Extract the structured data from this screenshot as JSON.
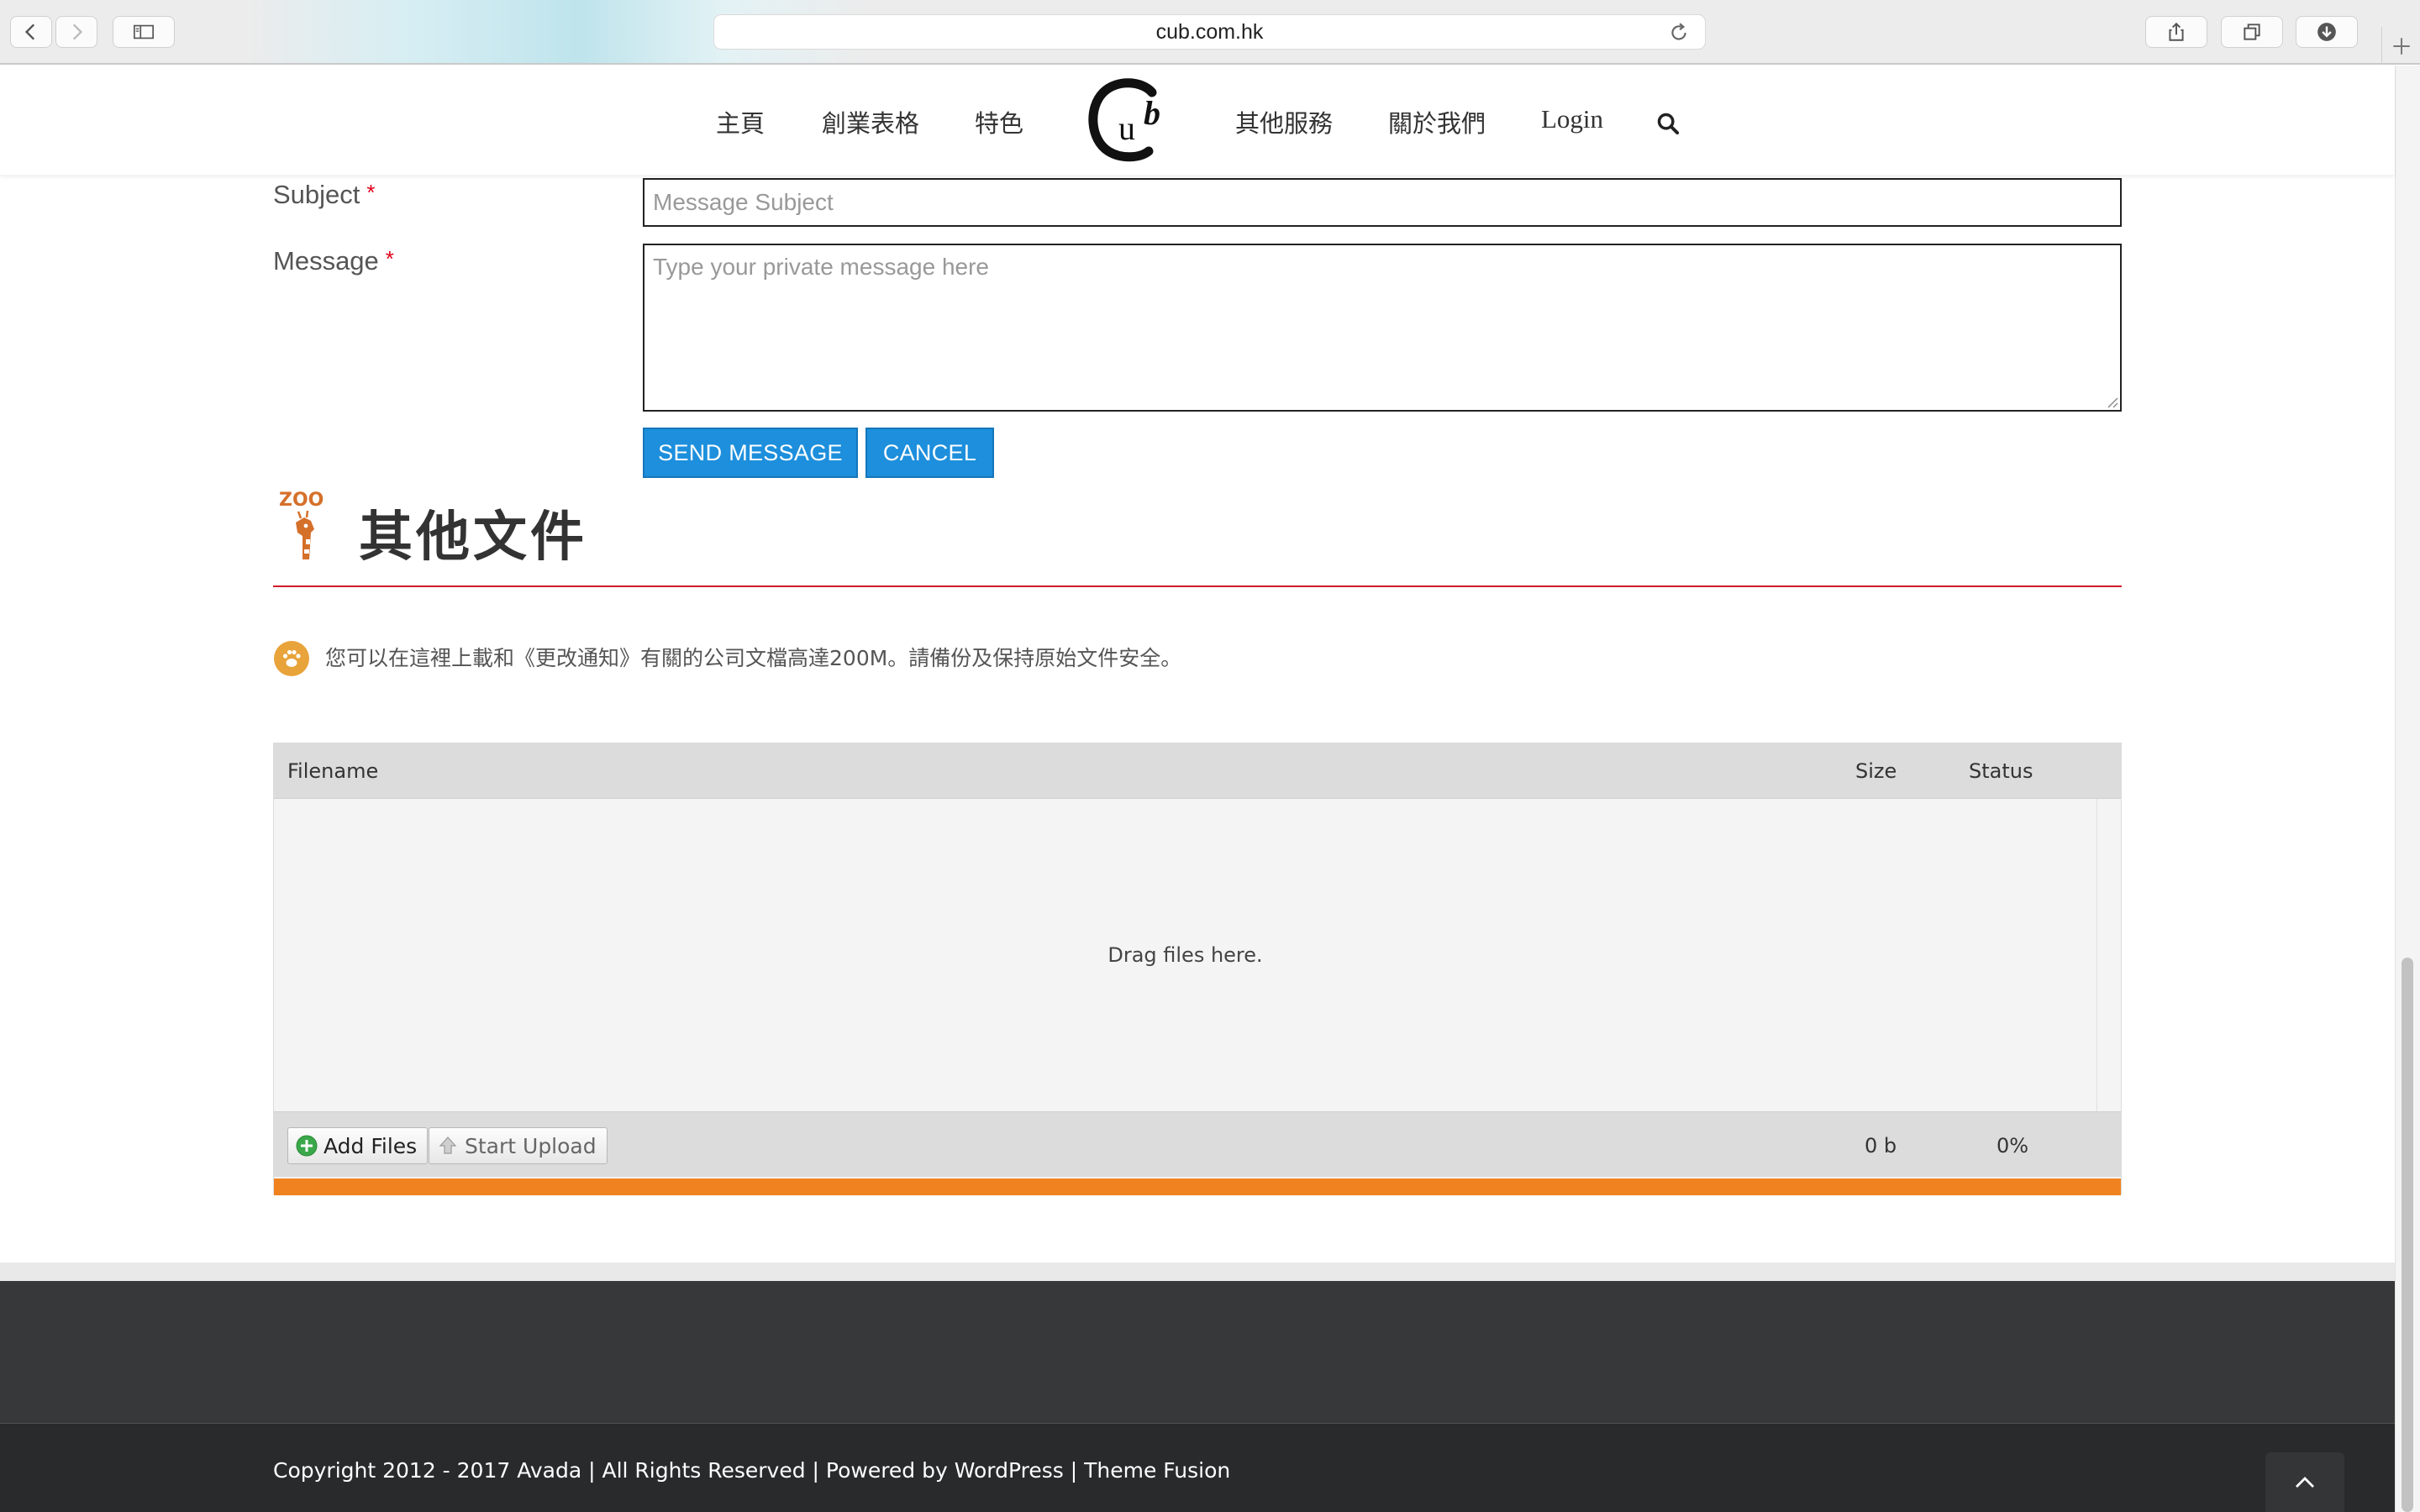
{
  "browser": {
    "url": "cub.com.hk"
  },
  "nav": {
    "home": "主頁",
    "startup_forms": "創業表格",
    "features": "特色",
    "logo_text": "Cub",
    "other_services": "其他服務",
    "about_us": "關於我們",
    "login": "Login"
  },
  "form": {
    "subject_label": "Subject",
    "subject_placeholder": "Message Subject",
    "message_label": "Message",
    "message_placeholder": "Type your private message here",
    "required_mark": "*",
    "send_label": "SEND MESSAGE",
    "cancel_label": "CANCEL"
  },
  "section": {
    "zoo_logo_text": "ZOO",
    "title": "其他文件",
    "notice": "您可以在這裡上載和《更改通知》有關的公司文檔高達200M。請備份及保持原始文件安全。"
  },
  "uploader": {
    "col_filename": "Filename",
    "col_size": "Size",
    "col_status": "Status",
    "drop_hint": "Drag files here.",
    "add_files_label": "Add Files",
    "start_upload_label": "Start Upload",
    "total_size": "0 b",
    "total_percent": "0%",
    "progress_color": "#f08320"
  },
  "footer": {
    "copyright": "Copyright 2012 - 2017 Avada | All Rights Reserved | Powered by WordPress | Theme Fusion"
  },
  "colors": {
    "accent_blue": "#1d8fdc",
    "section_rule": "#d11a2a",
    "brand_orange": "#e8a33a"
  }
}
